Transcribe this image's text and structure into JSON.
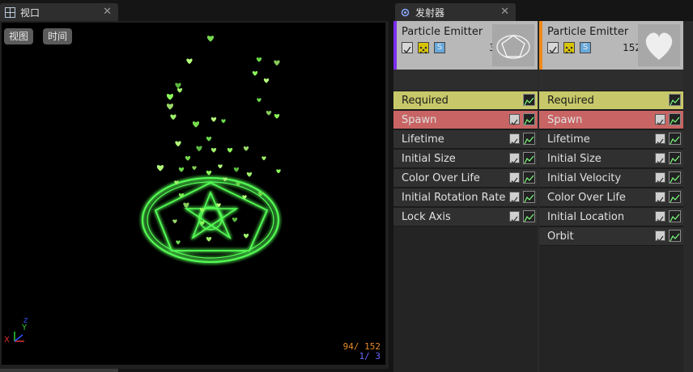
{
  "tabs": {
    "viewport": {
      "label": "视口"
    },
    "emitters": {
      "label": "发射器"
    }
  },
  "viewport": {
    "view_button": "视图",
    "time_button": "时间",
    "stats": {
      "line1": "94/ 152",
      "line2": "1/  3"
    },
    "axis": {
      "x": "X",
      "y": "Y",
      "z": "Z"
    },
    "colors": {
      "glow": "#3cff3c",
      "particle_count_color": "#e88a2a",
      "emitter_count_color": "#6060ff"
    }
  },
  "emitters": [
    {
      "title": "Particle Emitter",
      "count": "3",
      "accent_color": "#7a2df0",
      "modules": [
        {
          "label": "Required",
          "style": "required",
          "has_check": false
        },
        {
          "label": "Spawn",
          "style": "spawn",
          "has_check": true
        },
        {
          "label": "Lifetime",
          "style": "normal",
          "has_check": true
        },
        {
          "label": "Initial Size",
          "style": "normal",
          "has_check": true
        },
        {
          "label": "Color Over Life",
          "style": "normal",
          "has_check": true
        },
        {
          "label": "Initial Rotation Rate",
          "style": "normal",
          "has_check": true
        },
        {
          "label": "Lock Axis",
          "style": "normal",
          "has_check": true
        }
      ]
    },
    {
      "title": "Particle Emitter",
      "count": "152",
      "accent_color": "#f08a1a",
      "modules": [
        {
          "label": "Required",
          "style": "required",
          "has_check": false
        },
        {
          "label": "Spawn",
          "style": "spawn",
          "has_check": true
        },
        {
          "label": "Lifetime",
          "style": "normal",
          "has_check": true
        },
        {
          "label": "Initial Size",
          "style": "normal",
          "has_check": true
        },
        {
          "label": "Initial Velocity",
          "style": "normal",
          "has_check": true
        },
        {
          "label": "Color Over Life",
          "style": "normal",
          "has_check": true
        },
        {
          "label": "Initial Location",
          "style": "normal",
          "has_check": true
        },
        {
          "label": "Orbit",
          "style": "normal",
          "has_check": true
        }
      ]
    }
  ],
  "module_colors": {
    "required_bg": "#c8c86a",
    "required_text": "#1a1a1a",
    "spawn_bg": "#c86464",
    "normal_bg": "#303030",
    "normal_text": "#e0e0e0"
  }
}
